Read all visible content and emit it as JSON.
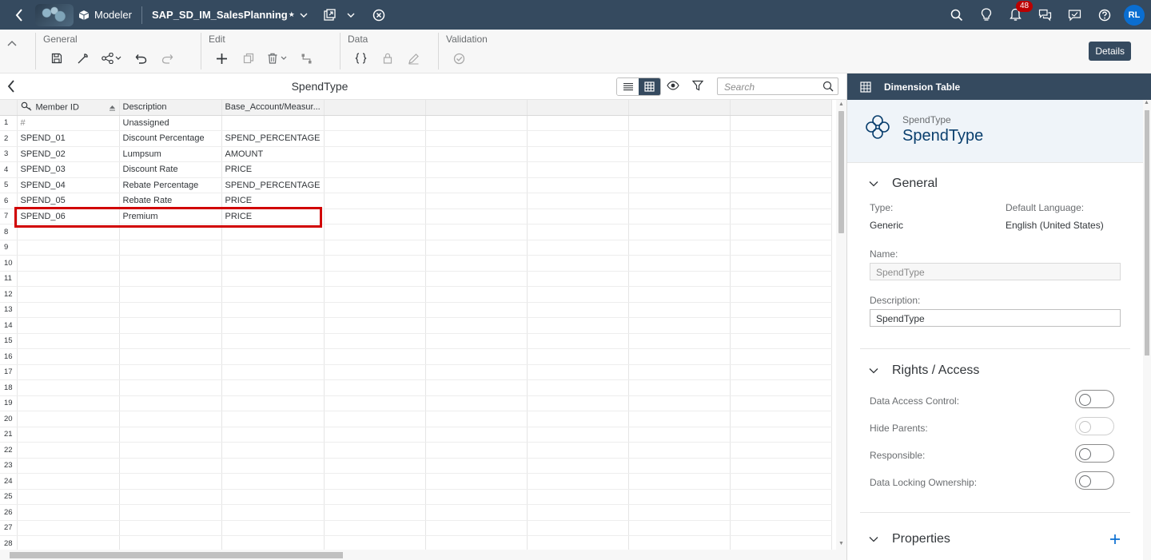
{
  "shell": {
    "app_name": "Modeler",
    "model_name": "SAP_SD_IM_SalesPlanning",
    "unsaved_marker": "★",
    "notification_count": "48",
    "avatar_initials": "RL"
  },
  "toolbar": {
    "groups": {
      "general": "General",
      "edit": "Edit",
      "data": "Data",
      "validation": "Validation"
    },
    "details_label": "Details"
  },
  "table_panel": {
    "title": "SpendType",
    "search_placeholder": "Search",
    "columns": [
      "Member ID",
      "Description",
      "Base_Account/Measur..."
    ],
    "row_numbers": [
      "1",
      "2",
      "3",
      "4",
      "5",
      "6",
      "7",
      "8",
      "9",
      "10",
      "11",
      "12",
      "13",
      "14",
      "15",
      "16",
      "17",
      "18",
      "19",
      "20",
      "21",
      "22",
      "23",
      "24",
      "25",
      "26",
      "27",
      "28"
    ],
    "rows": [
      [
        "#",
        "Unassigned",
        ""
      ],
      [
        "SPEND_01",
        "Discount Percentage",
        "SPEND_PERCENTAGE"
      ],
      [
        "SPEND_02",
        "Lumpsum",
        "AMOUNT"
      ],
      [
        "SPEND_03",
        "Discount Rate",
        "PRICE"
      ],
      [
        "SPEND_04",
        "Rebate Percentage",
        "SPEND_PERCENTAGE"
      ],
      [
        "SPEND_05",
        "Rebate Rate",
        "PRICE"
      ],
      [
        "SPEND_06",
        "Premium",
        "PRICE"
      ]
    ]
  },
  "details_panel": {
    "header": "Dimension Table",
    "object_type_label": "SpendType",
    "object_title": "SpendType",
    "general": {
      "title": "General",
      "type_label": "Type:",
      "type_value": "Generic",
      "language_label": "Default Language:",
      "language_value": "English (United States)",
      "name_label": "Name:",
      "name_value": "SpendType",
      "description_label": "Description:",
      "description_value": "SpendType"
    },
    "rights": {
      "title": "Rights / Access",
      "data_access_control": "Data Access Control:",
      "hide_parents": "Hide Parents:",
      "responsible": "Responsible:",
      "data_locking": "Data Locking Ownership:"
    },
    "properties": {
      "title": "Properties"
    }
  },
  "colors": {
    "shell_bg": "#354a5f",
    "accent": "#0a6ed1",
    "highlight_box": "#d10000",
    "badge": "#bb0000"
  }
}
